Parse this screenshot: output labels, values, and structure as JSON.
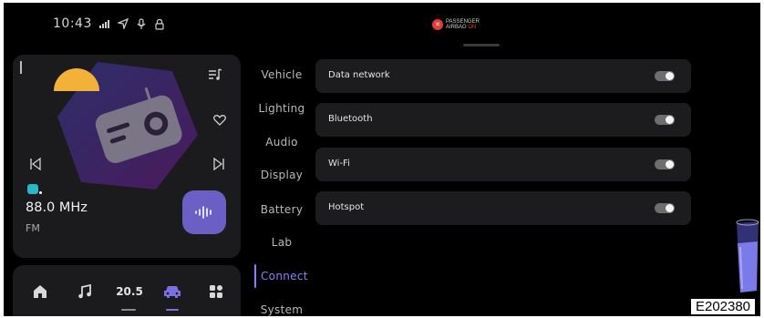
{
  "status_bar": {
    "time": "10:43",
    "icons": [
      "signal-icon",
      "navigation-icon",
      "microphone-icon",
      "lock-icon"
    ]
  },
  "airbag": {
    "line1": "PASSENGER",
    "line2": "AIRBAG",
    "state": "ON"
  },
  "media": {
    "frequency": "88.0 MHz",
    "band": "FM",
    "source_icon": "radio-source-icon"
  },
  "dock": {
    "temperature": "20.5",
    "active_item": "car",
    "accent": "#7c6fe0"
  },
  "menu": {
    "items": [
      "Vehicle",
      "Lighting",
      "Audio",
      "Display",
      "Battery",
      "Lab",
      "Connect",
      "System"
    ],
    "active": "Connect",
    "accent": "#8b7dff"
  },
  "settings": [
    {
      "label": "Data network",
      "enabled": false
    },
    {
      "label": "Bluetooth",
      "enabled": false
    },
    {
      "label": "Wi-Fi",
      "enabled": false
    },
    {
      "label": "Hotspot",
      "enabled": false
    }
  ],
  "figure_code": "E202380"
}
